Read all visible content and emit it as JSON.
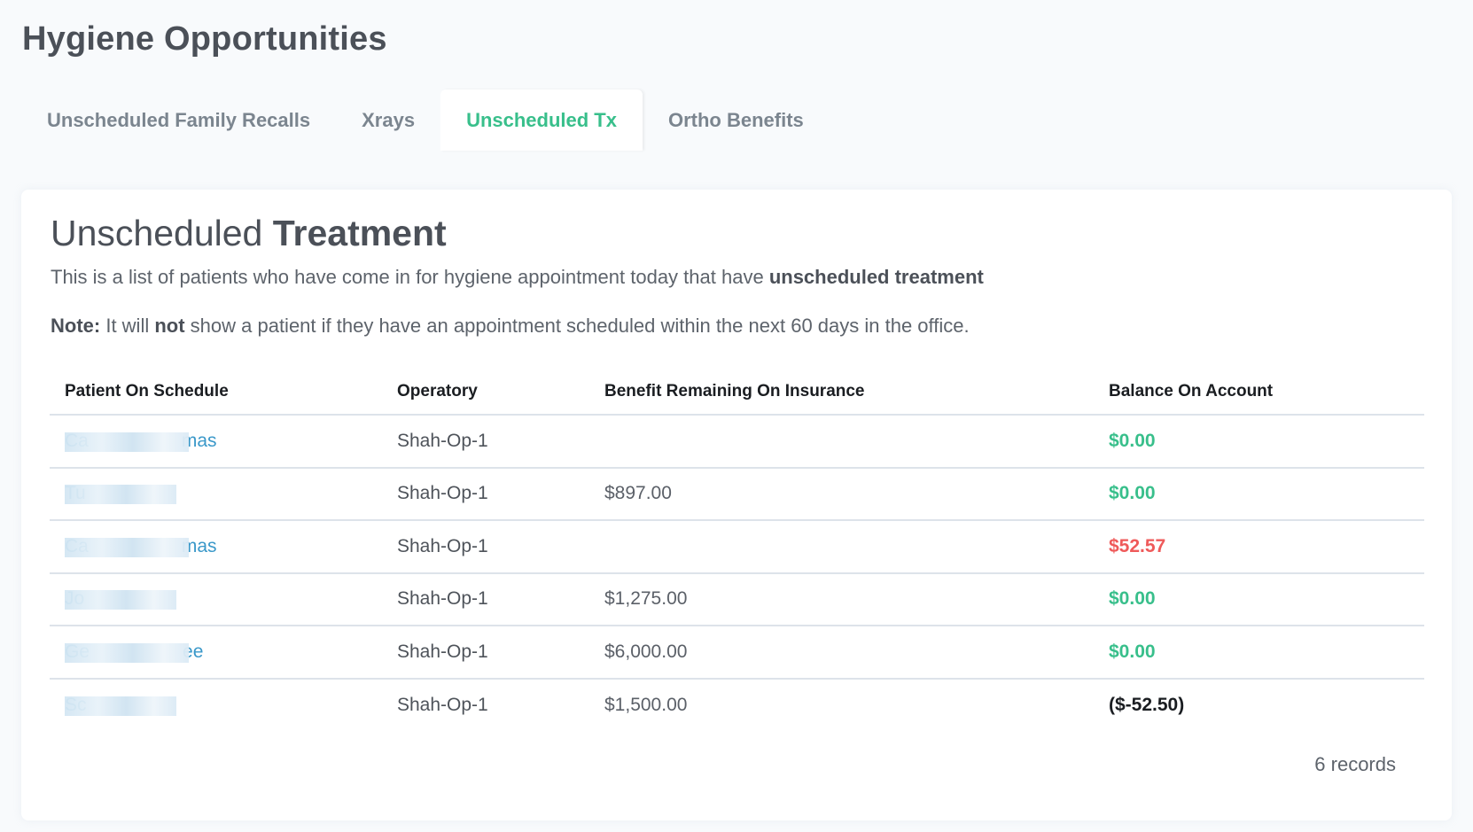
{
  "page": {
    "title": "Hygiene Opportunities"
  },
  "tabs": [
    {
      "label": "Unscheduled Family Recalls",
      "active": false
    },
    {
      "label": "Xrays",
      "active": false
    },
    {
      "label": "Unscheduled Tx",
      "active": true
    },
    {
      "label": "Ortho Benefits",
      "active": false
    }
  ],
  "card": {
    "title_light": "Unscheduled ",
    "title_bold": "Treatment",
    "description_prefix": "This is a list of patients who have come in for hygiene appointment today that have ",
    "description_bold": "unscheduled treatment",
    "note_label": "Note:",
    "note_part1": " It will ",
    "note_bold": "not",
    "note_part2": " show a patient if they have an appointment scheduled within the next 60 days in the office."
  },
  "table": {
    "columns": [
      "Patient On Schedule",
      "Operatory",
      "Benefit Remaining On Insurance",
      "Balance On Account"
    ],
    "rows": [
      {
        "patient": "Ca     mas",
        "operatory": "Shah-Op-1",
        "benefit": "",
        "balance": "$0.00",
        "balance_status": "zero"
      },
      {
        "patient": "Tu    ",
        "operatory": "Shah-Op-1",
        "benefit": "$897.00",
        "balance": "$0.00",
        "balance_status": "zero"
      },
      {
        "patient": "Ca     mas",
        "operatory": "Shah-Op-1",
        "benefit": "",
        "balance": "$52.57",
        "balance_status": "owed"
      },
      {
        "patient": "Jo    ",
        "operatory": "Shah-Op-1",
        "benefit": "$1,275.00",
        "balance": "$0.00",
        "balance_status": "zero"
      },
      {
        "patient": "Ge     ee",
        "operatory": "Shah-Op-1",
        "benefit": "$6,000.00",
        "balance": "$0.00",
        "balance_status": "zero"
      },
      {
        "patient": "Sc    ",
        "operatory": "Shah-Op-1",
        "benefit": "$1,500.00",
        "balance": "($-52.50)",
        "balance_status": "credit"
      }
    ],
    "records_label": "6 records"
  },
  "colors": {
    "accent_green": "#38bf8b",
    "alert_red": "#ef5a5a",
    "link_blue": "#3a98c9",
    "page_bg": "#f8fafc"
  }
}
